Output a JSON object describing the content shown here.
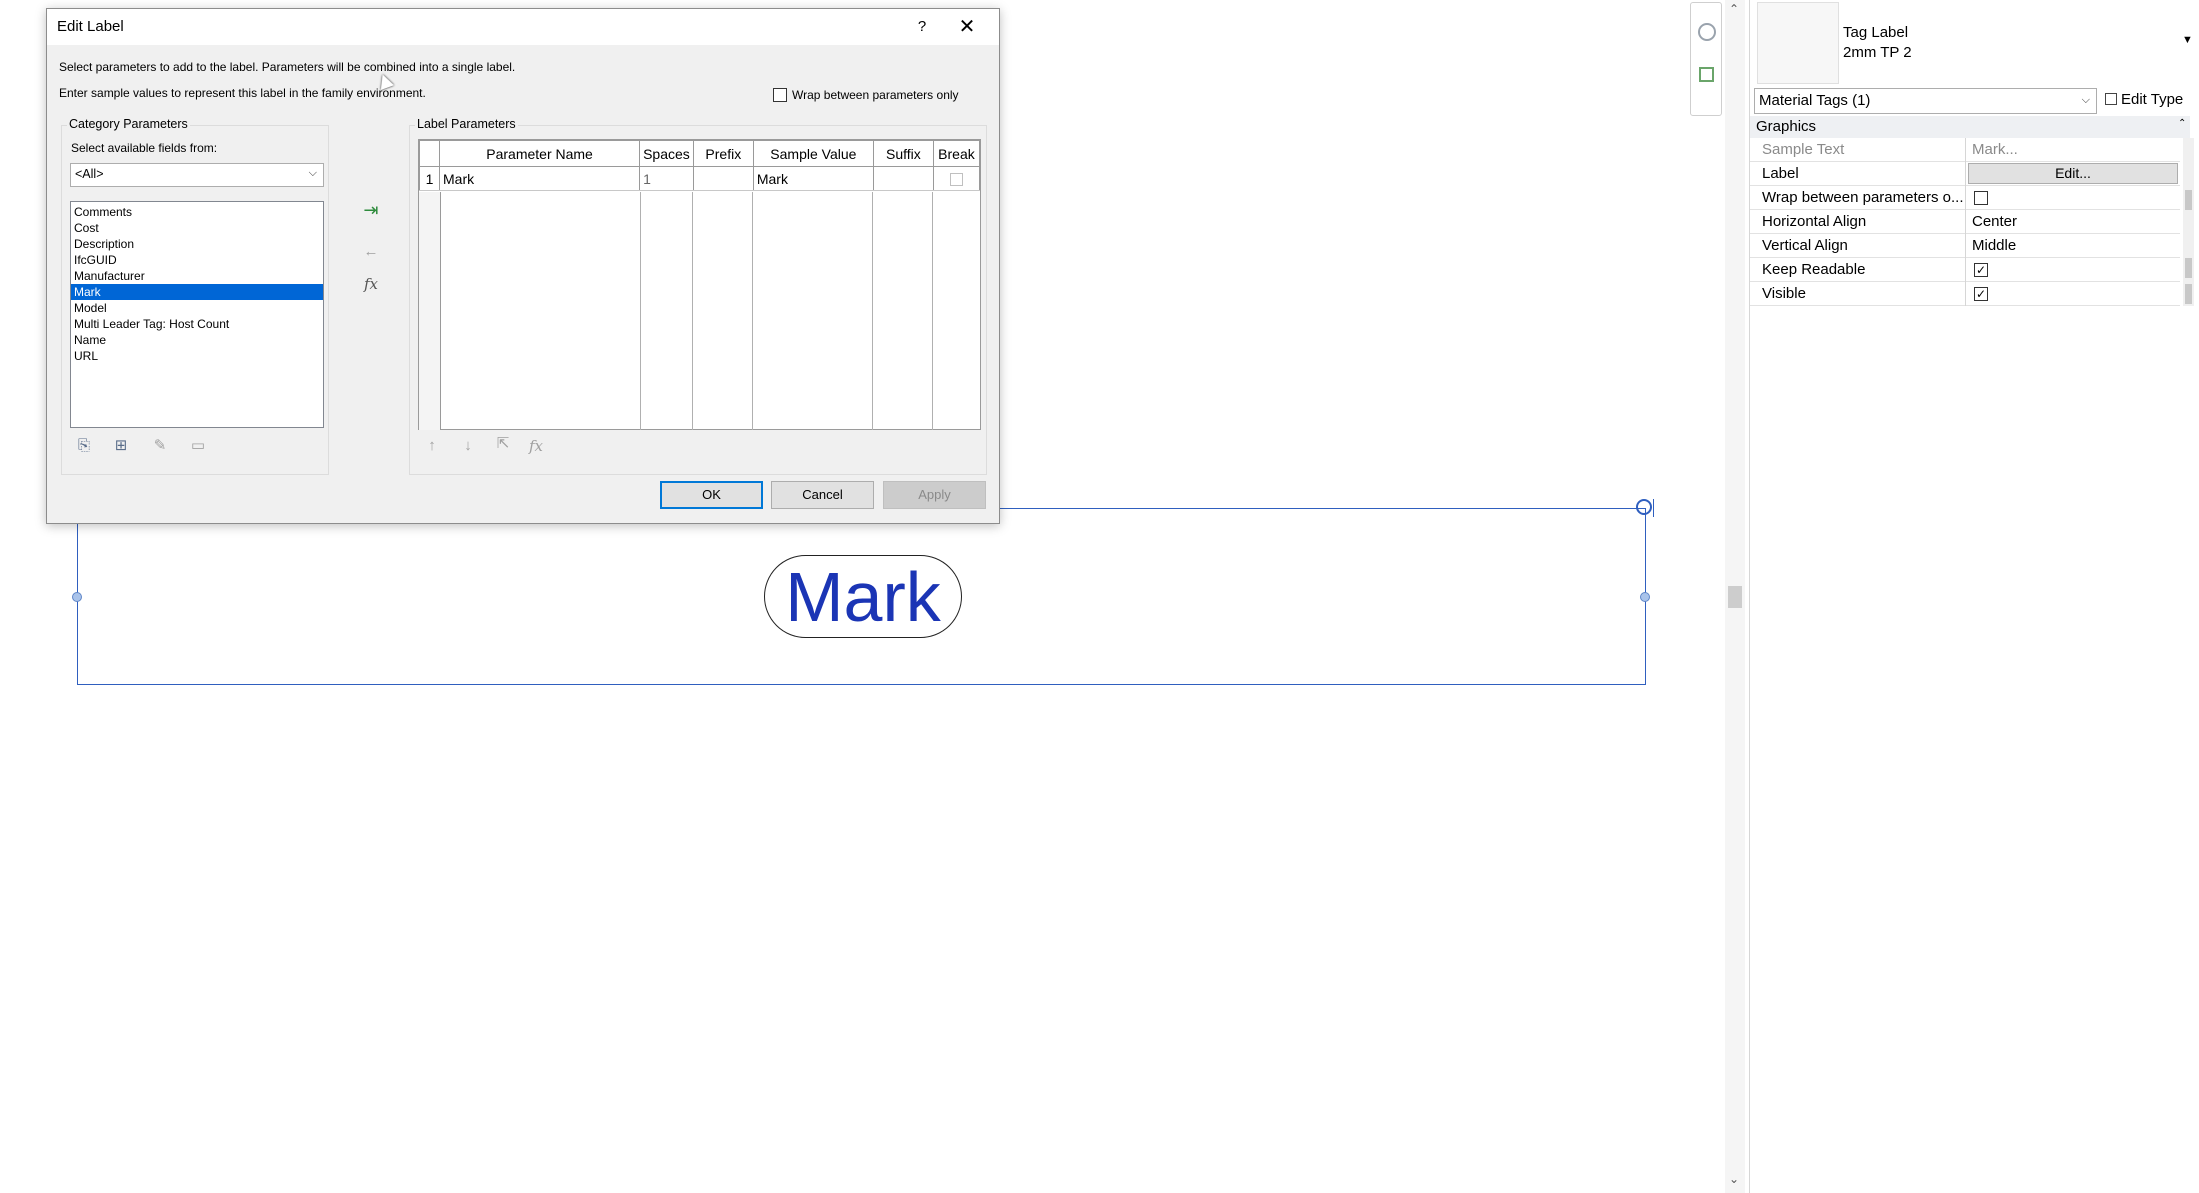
{
  "dialog": {
    "title": "Edit Label",
    "help": "?",
    "close": "✕",
    "instructions_1": "Select parameters to add to the label.  Parameters will be combined into a single label.",
    "instructions_2": "Enter sample values to represent this label in the family environment.",
    "wrap_checkbox_label": "Wrap between parameters only",
    "category_group_title": "Category Parameters",
    "select_fields_label": "Select available fields from:",
    "fields_combo_value": "<All>",
    "available_fields": [
      "Comments",
      "Cost",
      "Description",
      "IfcGUID",
      "Manufacturer",
      "Mark",
      "Model",
      "Multi Leader Tag: Host Count",
      "Name",
      "URL"
    ],
    "selected_field": "Mark",
    "label_group_title": "Label Parameters",
    "grid_headers": [
      "Parameter Name",
      "Spaces",
      "Prefix",
      "Sample Value",
      "Suffix",
      "Break"
    ],
    "grid_rows": [
      {
        "num": "1",
        "parameter_name": "Mark",
        "spaces": "1",
        "prefix": "",
        "sample_value": "Mark",
        "suffix": ""
      }
    ],
    "ok_label": "OK",
    "cancel_label": "Cancel",
    "apply_label": "Apply"
  },
  "canvas": {
    "tag_text": "Mark"
  },
  "properties": {
    "type_name": "Tag Label",
    "type_sub": "2mm TP 2",
    "instance_selector": "Material Tags (1)",
    "edit_type_label": "Edit Type",
    "section": "Graphics",
    "rows": [
      {
        "name": "Sample Text",
        "value": "Mark..."
      },
      {
        "name": "Label",
        "value": "Edit..."
      },
      {
        "name": "Wrap between parameters o...",
        "value": ""
      },
      {
        "name": "Horizontal Align",
        "value": "Center"
      },
      {
        "name": "Vertical Align",
        "value": "Middle"
      },
      {
        "name": "Keep Readable",
        "value": "checked"
      },
      {
        "name": "Visible",
        "value": "checked"
      }
    ]
  }
}
